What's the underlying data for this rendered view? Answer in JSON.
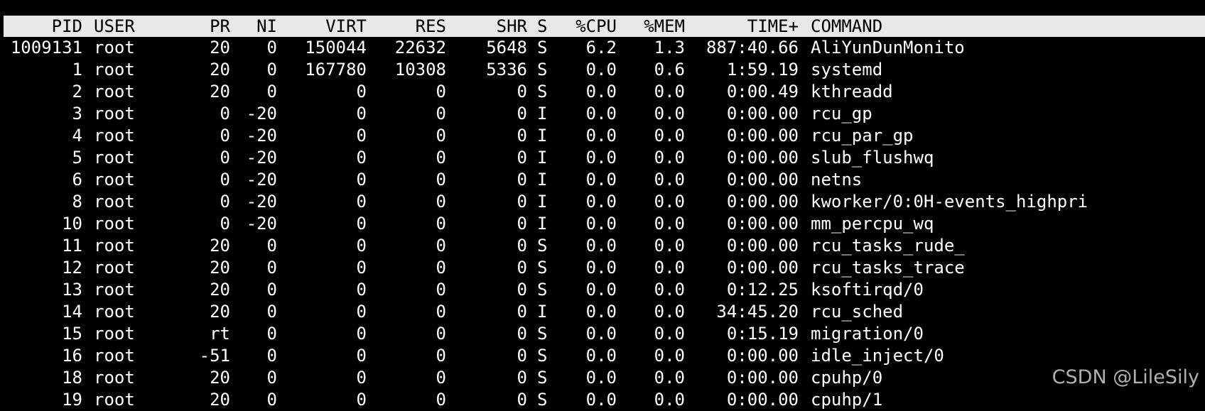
{
  "header": {
    "pid": "PID",
    "user": "USER",
    "pr": "PR",
    "ni": "NI",
    "virt": "VIRT",
    "res": "RES",
    "shr": "SHR",
    "s": "S",
    "cpu": "%CPU",
    "mem": "%MEM",
    "time": "TIME+",
    "command": "COMMAND"
  },
  "processes": [
    {
      "pid": "1009131",
      "user": "root",
      "pr": "20",
      "ni": "0",
      "virt": "150044",
      "res": "22632",
      "shr": "5648",
      "s": "S",
      "cpu": "6.2",
      "mem": "1.3",
      "time": "887:40.66",
      "command": "AliYunDunMonito"
    },
    {
      "pid": "1",
      "user": "root",
      "pr": "20",
      "ni": "0",
      "virt": "167780",
      "res": "10308",
      "shr": "5336",
      "s": "S",
      "cpu": "0.0",
      "mem": "0.6",
      "time": "1:59.19",
      "command": "systemd"
    },
    {
      "pid": "2",
      "user": "root",
      "pr": "20",
      "ni": "0",
      "virt": "0",
      "res": "0",
      "shr": "0",
      "s": "S",
      "cpu": "0.0",
      "mem": "0.0",
      "time": "0:00.49",
      "command": "kthreadd"
    },
    {
      "pid": "3",
      "user": "root",
      "pr": "0",
      "ni": "-20",
      "virt": "0",
      "res": "0",
      "shr": "0",
      "s": "I",
      "cpu": "0.0",
      "mem": "0.0",
      "time": "0:00.00",
      "command": "rcu_gp"
    },
    {
      "pid": "4",
      "user": "root",
      "pr": "0",
      "ni": "-20",
      "virt": "0",
      "res": "0",
      "shr": "0",
      "s": "I",
      "cpu": "0.0",
      "mem": "0.0",
      "time": "0:00.00",
      "command": "rcu_par_gp"
    },
    {
      "pid": "5",
      "user": "root",
      "pr": "0",
      "ni": "-20",
      "virt": "0",
      "res": "0",
      "shr": "0",
      "s": "I",
      "cpu": "0.0",
      "mem": "0.0",
      "time": "0:00.00",
      "command": "slub_flushwq"
    },
    {
      "pid": "6",
      "user": "root",
      "pr": "0",
      "ni": "-20",
      "virt": "0",
      "res": "0",
      "shr": "0",
      "s": "I",
      "cpu": "0.0",
      "mem": "0.0",
      "time": "0:00.00",
      "command": "netns"
    },
    {
      "pid": "8",
      "user": "root",
      "pr": "0",
      "ni": "-20",
      "virt": "0",
      "res": "0",
      "shr": "0",
      "s": "I",
      "cpu": "0.0",
      "mem": "0.0",
      "time": "0:00.00",
      "command": "kworker/0:0H-events_highpri"
    },
    {
      "pid": "10",
      "user": "root",
      "pr": "0",
      "ni": "-20",
      "virt": "0",
      "res": "0",
      "shr": "0",
      "s": "I",
      "cpu": "0.0",
      "mem": "0.0",
      "time": "0:00.00",
      "command": "mm_percpu_wq"
    },
    {
      "pid": "11",
      "user": "root",
      "pr": "20",
      "ni": "0",
      "virt": "0",
      "res": "0",
      "shr": "0",
      "s": "S",
      "cpu": "0.0",
      "mem": "0.0",
      "time": "0:00.00",
      "command": "rcu_tasks_rude_"
    },
    {
      "pid": "12",
      "user": "root",
      "pr": "20",
      "ni": "0",
      "virt": "0",
      "res": "0",
      "shr": "0",
      "s": "S",
      "cpu": "0.0",
      "mem": "0.0",
      "time": "0:00.00",
      "command": "rcu_tasks_trace"
    },
    {
      "pid": "13",
      "user": "root",
      "pr": "20",
      "ni": "0",
      "virt": "0",
      "res": "0",
      "shr": "0",
      "s": "S",
      "cpu": "0.0",
      "mem": "0.0",
      "time": "0:12.25",
      "command": "ksoftirqd/0"
    },
    {
      "pid": "14",
      "user": "root",
      "pr": "20",
      "ni": "0",
      "virt": "0",
      "res": "0",
      "shr": "0",
      "s": "I",
      "cpu": "0.0",
      "mem": "0.0",
      "time": "34:45.20",
      "command": "rcu_sched"
    },
    {
      "pid": "15",
      "user": "root",
      "pr": "rt",
      "ni": "0",
      "virt": "0",
      "res": "0",
      "shr": "0",
      "s": "S",
      "cpu": "0.0",
      "mem": "0.0",
      "time": "0:15.19",
      "command": "migration/0"
    },
    {
      "pid": "16",
      "user": "root",
      "pr": "-51",
      "ni": "0",
      "virt": "0",
      "res": "0",
      "shr": "0",
      "s": "S",
      "cpu": "0.0",
      "mem": "0.0",
      "time": "0:00.00",
      "command": "idle_inject/0"
    },
    {
      "pid": "18",
      "user": "root",
      "pr": "20",
      "ni": "0",
      "virt": "0",
      "res": "0",
      "shr": "0",
      "s": "S",
      "cpu": "0.0",
      "mem": "0.0",
      "time": "0:00.00",
      "command": "cpuhp/0"
    },
    {
      "pid": "19",
      "user": "root",
      "pr": "20",
      "ni": "0",
      "virt": "0",
      "res": "0",
      "shr": "0",
      "s": "S",
      "cpu": "0.0",
      "mem": "0.0",
      "time": "0:00.00",
      "command": "cpuhp/1"
    }
  ],
  "watermark": "CSDN @LileSily",
  "colors": {
    "background": "#000000",
    "text": "#ffffff",
    "header_bg": "#e8e8e8",
    "header_text": "#000000"
  }
}
